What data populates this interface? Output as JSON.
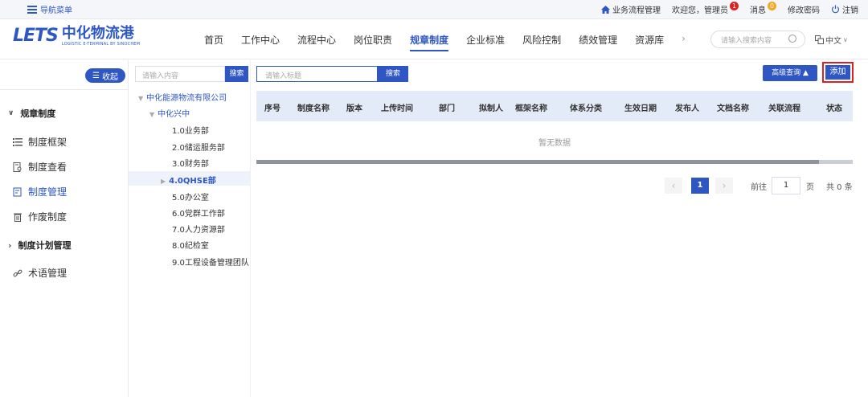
{
  "topbar": {
    "nav_menu": "导航菜单",
    "workflow": "业务流程管理",
    "welcome": "欢迎您，管理员",
    "welcome_badge": "1",
    "messages": "消息",
    "messages_badge": "0",
    "change_password": "修改密码",
    "logout": "注销"
  },
  "header": {
    "logo_text": "LETS",
    "logo_cn": "中化物流港",
    "logo_en": "LOGISTIC E-TERMINAL BY SINOCHEM",
    "nav": [
      "首页",
      "工作中心",
      "流程中心",
      "岗位职责",
      "规章制度",
      "企业标准",
      "风险控制",
      "绩效管理",
      "资源库"
    ],
    "active_nav": "规章制度",
    "more": "›",
    "search_placeholder": "请输入搜索内容",
    "language": "中文"
  },
  "sidebar": {
    "collapse_label": "收起",
    "group1": "规章制度",
    "items": [
      "制度框架",
      "制度查看",
      "制度管理",
      "作废制度"
    ],
    "group2": "制度计划管理",
    "glossary": "术语管理"
  },
  "tree": {
    "search_placeholder": "请输入内容",
    "search_button": "搜索",
    "root": "中化能源物流有限公司",
    "child": "中化兴中",
    "departments": [
      "1.0业务部",
      "2.0储运服务部",
      "3.0财务部",
      "4.0QHSE部",
      "5.0办公室",
      "6.0党群工作部",
      "7.0人力资源部",
      "8.0纪检室",
      "9.0工程设备管理团队"
    ],
    "selected": "4.0QHSE部"
  },
  "main": {
    "title_placeholder": "请输入标题",
    "search_button": "搜索",
    "advanced_button": "高级查询 ▲",
    "add_button": "添加",
    "columns": [
      "序号",
      "制度名称",
      "版本",
      "上传时间",
      "部门",
      "拟制人",
      "框架名称",
      "体系分类",
      "生效日期",
      "发布人",
      "文档名称",
      "关联流程",
      "状态"
    ],
    "empty_text": "暂无数据",
    "pagination": {
      "current_page": "1",
      "goto_label": "前往",
      "goto_value": "1",
      "page_unit": "页",
      "total": "共 0 条"
    }
  },
  "colors": {
    "primary": "#2e57c4",
    "header_bg": "#e4ebf8",
    "highlight_red": "#e0201f"
  }
}
